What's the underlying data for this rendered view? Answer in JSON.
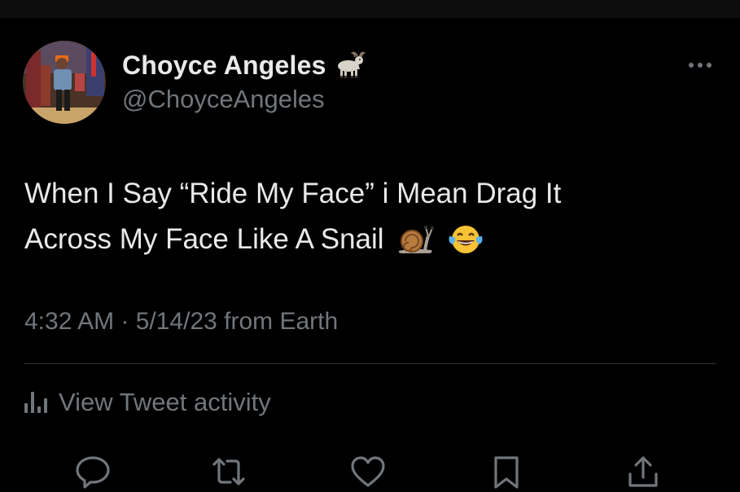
{
  "tweet": {
    "author": {
      "display_name": "Choyce Angeles",
      "handle": "@ChoyceAngeles",
      "name_emoji_icon": "goat-icon",
      "avatar": "profile-photo"
    },
    "text_lines": [
      "When I Say “Ride My Face” i Mean Drag It",
      "Across My Face Like A Snail"
    ],
    "text_emojis": [
      "snail-icon",
      "face-with-tears-of-joy-icon"
    ],
    "meta": "4:32 AM · 5/14/23 from Earth",
    "activity_label": "View Tweet activity",
    "more_icon": "more-options-icon",
    "actions": [
      "reply-icon",
      "retweet-icon",
      "like-icon",
      "bookmark-icon",
      "share-icon"
    ]
  },
  "colors": {
    "background": "#000000",
    "primary_text": "#e7e9ea",
    "secondary_text": "#71767b",
    "divider": "#2f3336"
  }
}
